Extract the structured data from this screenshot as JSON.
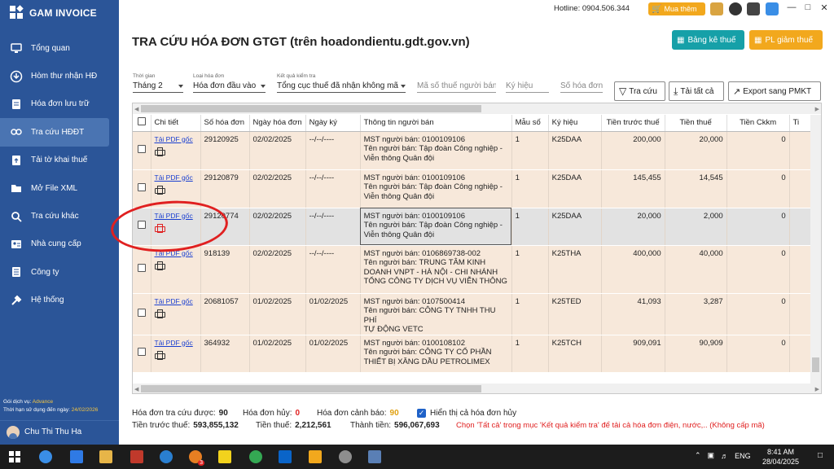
{
  "app": {
    "name": "GAM INVOICE"
  },
  "sidebar": {
    "items": [
      {
        "label": "Tổng quan",
        "icon": "monitor-icon"
      },
      {
        "label": "Hòm thư nhận HĐ",
        "icon": "inbox-download-icon"
      },
      {
        "label": "Hóa đơn lưu trữ",
        "icon": "document-icon"
      },
      {
        "label": "Tra cứu HĐĐT",
        "icon": "link-icon",
        "active": true
      },
      {
        "label": "Tải tờ khai thuế",
        "icon": "file-upload-icon"
      },
      {
        "label": "Mở File XML",
        "icon": "folder-icon"
      },
      {
        "label": "Tra cứu khác",
        "icon": "search-icon"
      },
      {
        "label": "Nhà cung cấp",
        "icon": "contacts-icon"
      },
      {
        "label": "Công ty",
        "icon": "building-icon"
      },
      {
        "label": "Hệ thống",
        "icon": "tools-icon"
      }
    ],
    "service_label": "Gói dịch vụ:",
    "service_value": "Advance",
    "expiry_label": "Thời hạn sử dụng đến ngày:",
    "expiry_value": "24/02/2026",
    "user": "Chu Thi Thu Ha"
  },
  "topbar": {
    "hotline": "Hotline: 0904.506.344",
    "buy_label": "Mua thêm"
  },
  "header": {
    "title": "TRA CỨU HÓA ĐƠN GTGT (trên hoadondientu.gdt.gov.vn)",
    "btn_bangke": "Bảng kê thuế",
    "btn_plgiam": "PL giảm thuế"
  },
  "filters": {
    "thoigian_label": "Thời gian",
    "thoigian_value": "Tháng 2",
    "loaihd_label": "Loại hóa đơn",
    "loaihd_value": "Hóa đơn đầu vào",
    "kq_label": "Kết quả kiểm tra",
    "kq_value": "Tổng cục thuế đã nhận không mã",
    "mst_placeholder": "Mã số thuế người bán",
    "kyhieu_placeholder": "Ký hiệu",
    "sohd_placeholder": "Số hóa đơn"
  },
  "actions": {
    "search": "Tra cứu",
    "download_all": "Tải tất cả",
    "export": "Export sang PMKT"
  },
  "table": {
    "columns": [
      "Chi tiết",
      "Số hóa đơn",
      "Ngày hóa đơn",
      "Ngày ký",
      "Thông tin người bán",
      "Mẫu số",
      "Ký hiệu",
      "Tiền trước thuế",
      "Tiền thuế",
      "Tiền Ckkm",
      "Ti"
    ],
    "pdf_link": "Tải PDF gốc",
    "rows": [
      {
        "so": "29120925",
        "ngay": "02/02/2025",
        "ky": "--/--/----",
        "info": [
          "MST người bán: 0100109106",
          "Tên người bán: Tập đoàn Công nghiệp -",
          "Viễn thông Quân đội"
        ],
        "mau": "1",
        "kyhieu": "K25DAA",
        "truoc": "200,000",
        "thue": "20,000",
        "ckkm": "0"
      },
      {
        "so": "29120879",
        "ngay": "02/02/2025",
        "ky": "--/--/----",
        "info": [
          "MST người bán: 0100109106",
          "Tên người bán: Tập đoàn Công nghiệp -",
          "Viễn thông Quân đội"
        ],
        "mau": "1",
        "kyhieu": "K25DAA",
        "truoc": "145,455",
        "thue": "14,545",
        "ckkm": "0"
      },
      {
        "so": "29120774",
        "ngay": "02/02/2025",
        "ky": "--/--/----",
        "info": [
          "MST người bán: 0100109106",
          "Tên người bán: Tập đoàn Công nghiệp -",
          "Viễn thông Quân đội"
        ],
        "mau": "1",
        "kyhieu": "K25DAA",
        "truoc": "20,000",
        "thue": "2,000",
        "ckkm": "0"
      },
      {
        "so": "918139",
        "ngay": "02/02/2025",
        "ky": "--/--/----",
        "info": [
          "MST người bán: 0106869738-002",
          "Tên người bán: TRUNG TÂM KINH",
          "DOANH VNPT - HÀ NỘI - CHI NHÁNH",
          "TỔNG CÔNG TY DỊCH VỤ VIỄN THÔNG"
        ],
        "mau": "1",
        "kyhieu": "K25THA",
        "truoc": "400,000",
        "thue": "40,000",
        "ckkm": "0"
      },
      {
        "so": "20681057",
        "ngay": "01/02/2025",
        "ky": "01/02/2025",
        "info": [
          "MST người bán: 0107500414",
          "Tên người bán: CÔNG TY TNHH THU PHÍ",
          "TỰ ĐỘNG VETC"
        ],
        "mau": "1",
        "kyhieu": "K25TED",
        "truoc": "41,093",
        "thue": "3,287",
        "ckkm": "0"
      },
      {
        "so": "364932",
        "ngay": "01/02/2025",
        "ky": "01/02/2025",
        "info": [
          "MST người bán: 0100108102",
          "Tên người bán: CÔNG TY CỔ PHẦN",
          "THIẾT BỊ XĂNG DẦU PETROLIMEX"
        ],
        "mau": "1",
        "kyhieu": "K25TCH",
        "truoc": "909,091",
        "thue": "90,909",
        "ckkm": "0"
      }
    ]
  },
  "footer": {
    "tracuu_label": "Hóa đơn tra cứu được:",
    "tracuu_value": "90",
    "huy_label": "Hóa đơn hủy:",
    "huy_value": "0",
    "canhbao_label": "Hóa đơn cảnh báo:",
    "canhbao_value": "90",
    "show_cancel_label": "Hiển thị cả hóa đơn hủy",
    "truocthue_label": "Tiền trước thuế:",
    "truocthue_value": "593,855,132",
    "tienthue_label": "Tiền thuế:",
    "tienthue_value": "2,212,561",
    "thanhtien_label": "Thành tiền:",
    "thanhtien_value": "596,067,693",
    "note": "Chọn 'Tất cả' trong mục 'Kết quả kiểm tra' để tải cả hóa đơn điện, nước,.. (Không cấp mã)"
  },
  "taskbar": {
    "lang": "ENG",
    "time": "8:41 AM",
    "date": "28/04/2025",
    "badge": "3"
  },
  "colors": {
    "sidebar": "#2b5598",
    "teal": "#16a0a8",
    "orange": "#f2a81d",
    "row": "#f7e8da",
    "annotation": "#e02020"
  }
}
